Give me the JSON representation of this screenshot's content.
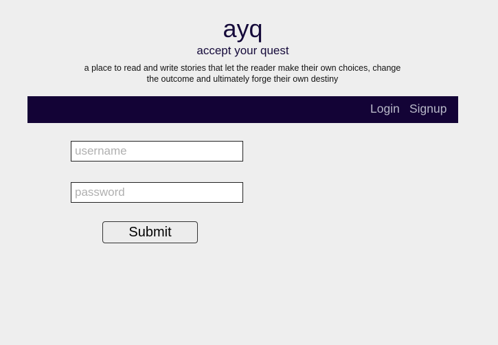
{
  "header": {
    "logo": "ayq",
    "tagline": "accept your quest",
    "description_line1": "a place to read and write stories that let the reader make their own choices, change",
    "description_line2": "the outcome and ultimately forge their own destiny"
  },
  "nav": {
    "login_label": "Login",
    "signup_label": "Signup"
  },
  "form": {
    "username_placeholder": "username",
    "username_value": "",
    "password_placeholder": "password",
    "password_value": "",
    "submit_label": "Submit"
  },
  "colors": {
    "background": "#eeeeee",
    "navbar": "#130336",
    "title_text": "#150a3a",
    "nav_link": "#b8b8c8"
  }
}
